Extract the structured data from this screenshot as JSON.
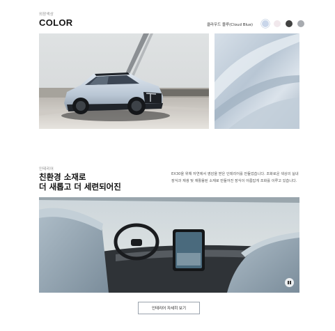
{
  "color_section": {
    "eyebrow": "외장색상",
    "title": "COLOR",
    "selected_color_name": "클라우드 블루(Cloud Blue)",
    "swatches": [
      {
        "name": "cloud-blue",
        "hex": "#c9d6ea",
        "selected": true
      },
      {
        "name": "light-pink",
        "hex": "#f1e8ec",
        "selected": false
      },
      {
        "name": "onyx-black",
        "hex": "#424242",
        "selected": false
      },
      {
        "name": "grey",
        "hex": "#a8abb0",
        "selected": false
      }
    ]
  },
  "interior_section": {
    "eyebrow": "인테리어",
    "title_line1": "친환경 소재로",
    "title_line2": "더 새롭고 더 세련되어진",
    "description": "EX30을 위해 자연에서 영감을 받은 인테리어를 만들었습니다. 조화로운 색상의 실내 장식과 재생 및 재활용된 소재로 만들어진 장식이 아름답게 조화를 이루고 있습니다.",
    "more_button_label": "인테리어 자세히 보기"
  },
  "icons": {
    "pause": "pause-icon"
  }
}
